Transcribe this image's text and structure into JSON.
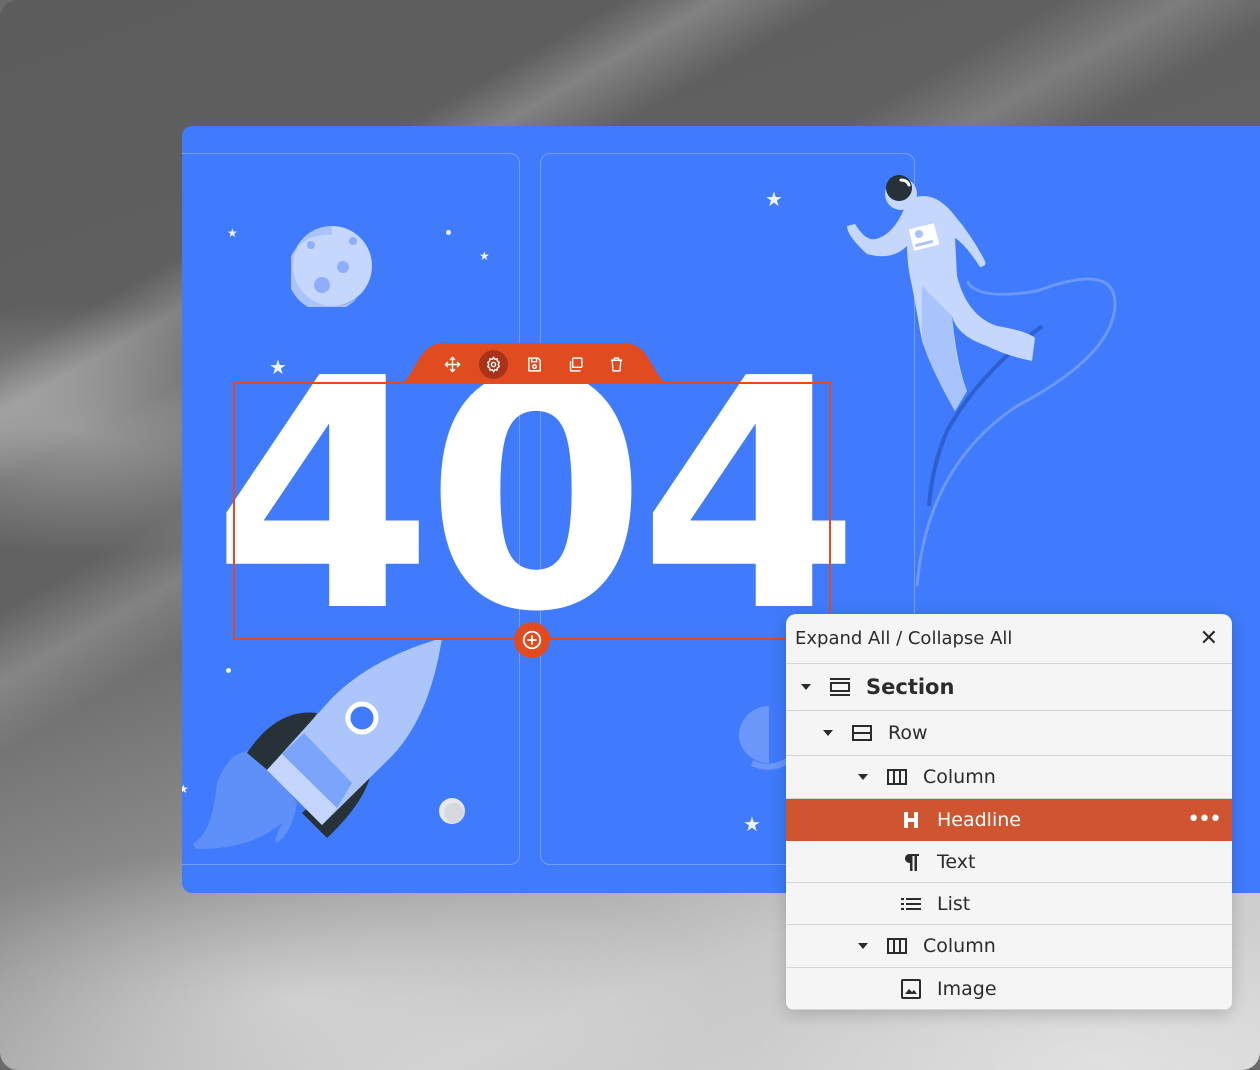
{
  "canvas": {
    "headline": "404",
    "colors": {
      "canvas_bg": "#3f7bfc",
      "accent": "#e04b1f",
      "selected_row": "#cf5530",
      "panel_bg": "#f5f5f5"
    }
  },
  "element_toolbar": {
    "buttons": [
      {
        "name": "move",
        "icon": "move-icon"
      },
      {
        "name": "settings",
        "icon": "gear-icon",
        "active": true
      },
      {
        "name": "save",
        "icon": "save-icon"
      },
      {
        "name": "duplicate",
        "icon": "duplicate-icon"
      },
      {
        "name": "delete",
        "icon": "trash-icon"
      }
    ]
  },
  "add_button": {
    "icon": "plus-circle-icon"
  },
  "navigator": {
    "title": "Expand All / Collapse All",
    "close_icon": "close-icon",
    "tree": [
      {
        "label": "Section",
        "icon": "section-icon",
        "expanded": true,
        "level": 0
      },
      {
        "label": "Row",
        "icon": "row-icon",
        "expanded": true,
        "level": 1
      },
      {
        "label": "Column",
        "icon": "column-icon",
        "expanded": true,
        "level": 2
      },
      {
        "label": "Headline",
        "icon": "heading-icon",
        "level": 3,
        "selected": true,
        "more": "•••"
      },
      {
        "label": "Text",
        "icon": "paragraph-icon",
        "level": 3
      },
      {
        "label": "List",
        "icon": "list-icon",
        "level": 3
      },
      {
        "label": "Column",
        "icon": "column-icon",
        "expanded": true,
        "level": 2
      },
      {
        "label": "Image",
        "icon": "image-icon",
        "level": 3
      }
    ]
  }
}
